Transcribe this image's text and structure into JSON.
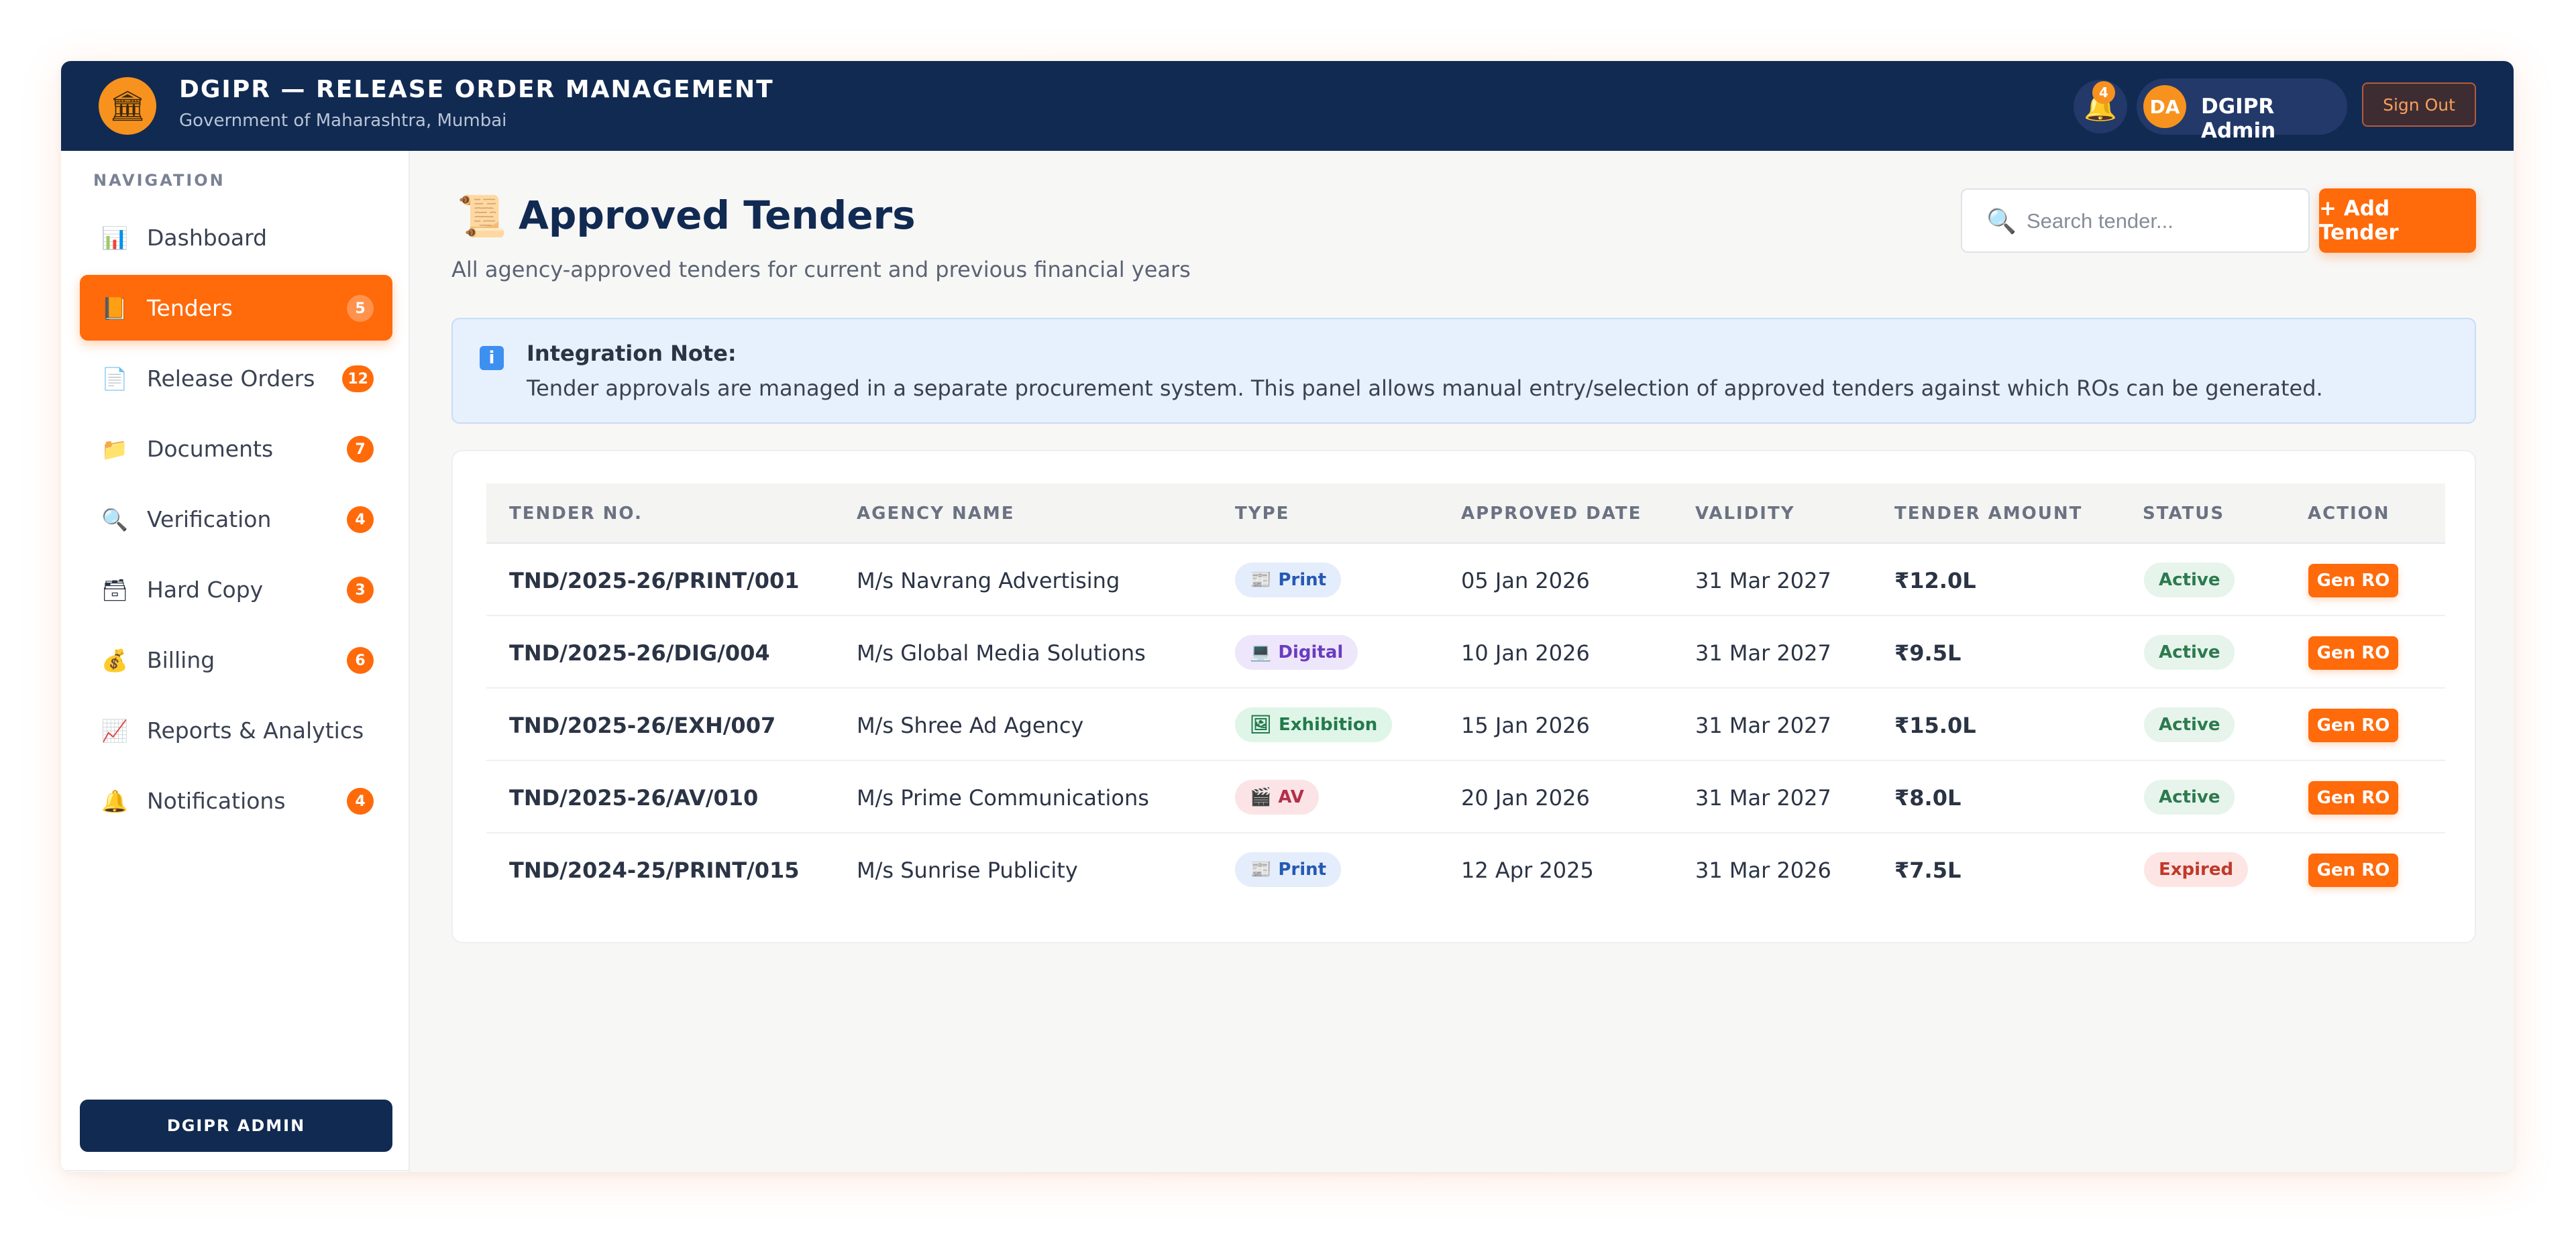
{
  "header": {
    "logo_icon": "government-building-icon",
    "title": "DGIPR — RELEASE ORDER MANAGEMENT",
    "subtitle": "Government of Maharashtra, Mumbai",
    "notification_count": "4",
    "user_initials": "DA",
    "user_name": "DGIPR Admin",
    "sign_out_label": "Sign Out"
  },
  "sidebar": {
    "heading": "NAVIGATION",
    "items": [
      {
        "label": "Dashboard",
        "icon": "📊",
        "badge": ""
      },
      {
        "label": "Tenders",
        "icon": "📙",
        "badge": "5",
        "active": true
      },
      {
        "label": "Release Orders",
        "icon": "📄",
        "badge": "12"
      },
      {
        "label": "Documents",
        "icon": "📁",
        "badge": "7"
      },
      {
        "label": "Verification",
        "icon": "🔍",
        "badge": "4"
      },
      {
        "label": "Hard Copy",
        "icon": "🗃",
        "badge": "3"
      },
      {
        "label": "Billing",
        "icon": "💰",
        "badge": "6"
      },
      {
        "label": "Reports & Analytics",
        "icon": "📈",
        "badge": ""
      },
      {
        "label": "Notifications",
        "icon": "🔔",
        "badge": "4"
      }
    ],
    "footer_label": "DGIPR ADMIN"
  },
  "main": {
    "page_icon": "📜",
    "title": "Approved Tenders",
    "subtitle": "All agency-approved tenders for current and previous financial years",
    "search_placeholder": "Search tender...",
    "add_button_label": "+ Add Tender",
    "note": {
      "title": "Integration Note:",
      "text": "Tender approvals are managed in a separate procurement system. This panel allows manual entry/selection of approved tenders against which ROs can be generated."
    },
    "table": {
      "columns": [
        "TENDER NO.",
        "AGENCY NAME",
        "TYPE",
        "APPROVED DATE",
        "VALIDITY",
        "TENDER AMOUNT",
        "STATUS",
        "ACTION"
      ],
      "rows": [
        {
          "tender_no": "TND/2025-26/PRINT/001",
          "agency": "M/s Navrang Advertising",
          "type": "Print",
          "type_icon": "📰",
          "approved": "05 Jan 2026",
          "validity": "31 Mar 2027",
          "amount": "₹12.0L",
          "status": "Active",
          "action": "Gen RO"
        },
        {
          "tender_no": "TND/2025-26/DIG/004",
          "agency": "M/s Global Media Solutions",
          "type": "Digital",
          "type_icon": "💻",
          "approved": "10 Jan 2026",
          "validity": "31 Mar 2027",
          "amount": "₹9.5L",
          "status": "Active",
          "action": "Gen RO"
        },
        {
          "tender_no": "TND/2025-26/EXH/007",
          "agency": "M/s Shree Ad Agency",
          "type": "Exhibition",
          "type_icon": "🖼",
          "approved": "15 Jan 2026",
          "validity": "31 Mar 2027",
          "amount": "₹15.0L",
          "status": "Active",
          "action": "Gen RO"
        },
        {
          "tender_no": "TND/2025-26/AV/010",
          "agency": "M/s Prime Communications",
          "type": "AV",
          "type_icon": "🎬",
          "approved": "20 Jan 2026",
          "validity": "31 Mar 2027",
          "amount": "₹8.0L",
          "status": "Active",
          "action": "Gen RO"
        },
        {
          "tender_no": "TND/2024-25/PRINT/015",
          "agency": "M/s Sunrise Publicity",
          "type": "Print",
          "type_icon": "📰",
          "approved": "12 Apr 2025",
          "validity": "31 Mar 2026",
          "amount": "₹7.5L",
          "status": "Expired",
          "action": "Gen RO"
        }
      ]
    }
  },
  "colors": {
    "header_bg": "#112a52",
    "accent": "#ff6a0b",
    "active_status_bg": "#e6f4ec",
    "active_status_fg": "#2c7a4e",
    "expired_status_bg": "#fde5e3",
    "expired_status_fg": "#c0392b"
  }
}
